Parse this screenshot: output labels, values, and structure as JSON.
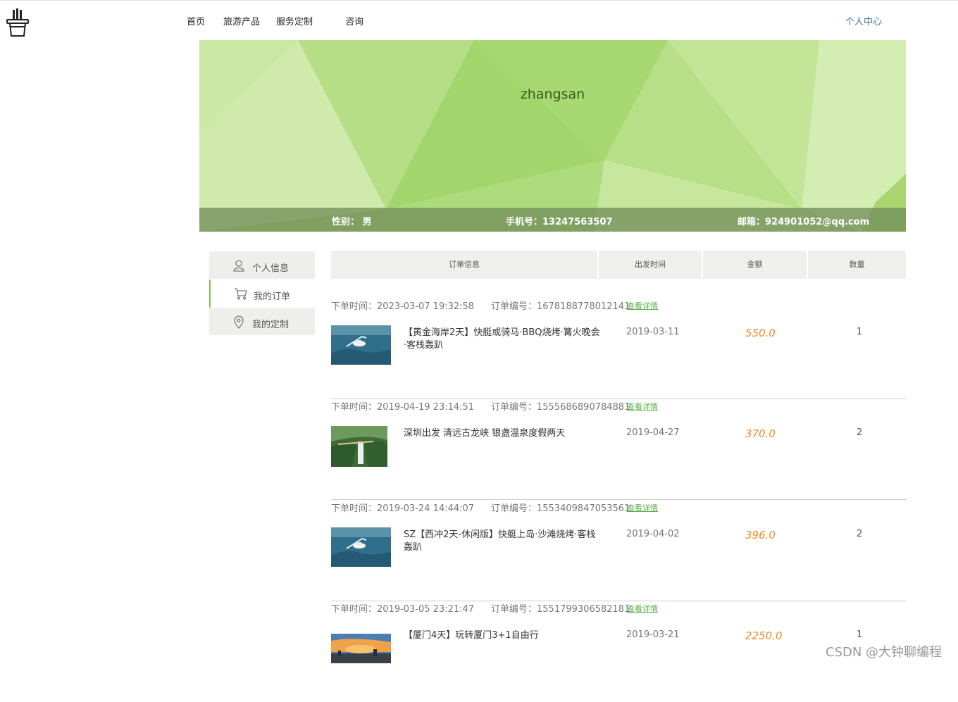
{
  "nav": {
    "home": "首页",
    "products": "旅游产品",
    "custom": "服务定制",
    "consult": "咨询",
    "user_center": "个人中心"
  },
  "profile": {
    "username": "zhangsan",
    "gender": "性别：  男",
    "phone": "手机号：13247563507",
    "email": "邮箱：924901052@qq.com"
  },
  "sidebar": {
    "items": [
      {
        "label": "个人信息",
        "icon": "user-icon"
      },
      {
        "label": "我的订单",
        "icon": "cart-icon"
      },
      {
        "label": "我的定制",
        "icon": "location-pin-icon"
      }
    ]
  },
  "table": {
    "headers": [
      "订单信息",
      "出发时间",
      "金额",
      "数量"
    ]
  },
  "orders": [
    {
      "time": "下单时间：2023-03-07 19:32:58",
      "no": "订单编号：1678188778012141",
      "link": "查看详情",
      "name": "【黄金海岸2天】快艇或骑马·BBQ烧烤·篝火晚会·客栈轰趴",
      "depart": "2019-03-11",
      "price": "550.0",
      "qty": "1"
    },
    {
      "time": "下单时间：2019-04-19 23:14:51",
      "no": "订单编号：1555686890784881",
      "link": "查看详情",
      "name": "深圳出发 清远古龙峡 银盏温泉度假两天",
      "depart": "2019-04-27",
      "price": "370.0",
      "qty": "2"
    },
    {
      "time": "下单时间：2019-03-24 14:44:07",
      "no": "订单编号：1553409847053561",
      "link": "查看详情",
      "name": "SZ【西冲2天-休闲版】快艇上岛·沙滩烧烤·客栈轰趴",
      "depart": "2019-04-02",
      "price": "396.0",
      "qty": "2"
    },
    {
      "time": "下单时间：2019-03-05 23:21:47",
      "no": "订单编号：1551799306582181",
      "link": "查看详情",
      "name": "【厦门4天】玩转厦门3+1自由行",
      "depart": "2019-03-21",
      "price": "2250.0",
      "qty": "1"
    }
  ],
  "watermark": "CSDN @大钟聊编程"
}
